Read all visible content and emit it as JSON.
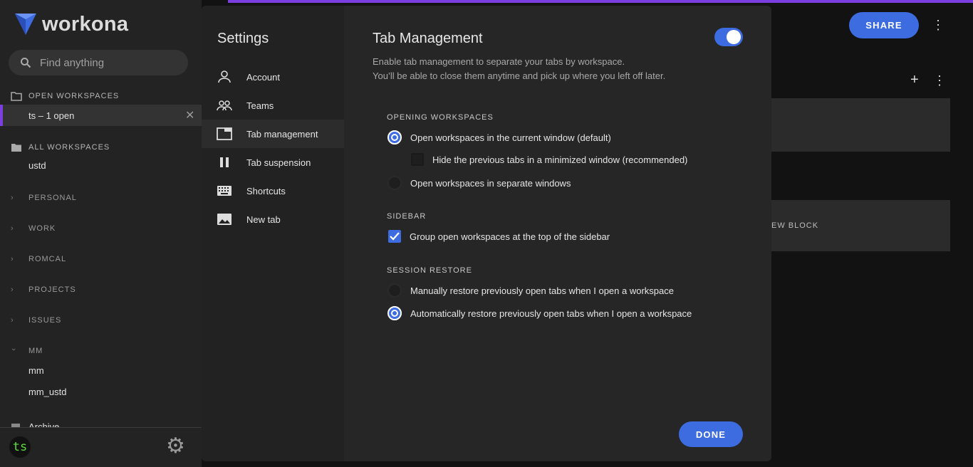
{
  "app": {
    "logo_text": "workona"
  },
  "search": {
    "placeholder": "Find anything"
  },
  "sidebar": {
    "open_workspaces_title": "OPEN WORKSPACES",
    "open_item_label": "ts – 1 open",
    "all_workspaces_title": "ALL WORKSPACES",
    "all_item": "ustd",
    "groups": [
      "PERSONAL",
      "WORK",
      "ROMCAL",
      "PROJECTS",
      "ISSUES",
      "MM"
    ],
    "mm_items": [
      "mm",
      "mm_ustd"
    ],
    "archive": "Archive",
    "avatar_text": "ts"
  },
  "header": {
    "share_label": "SHARE"
  },
  "background": {
    "new_block_label": "EW BLOCK"
  },
  "settings": {
    "title": "Settings",
    "nav": [
      "Account",
      "Teams",
      "Tab management",
      "Tab suspension",
      "Shortcuts",
      "New tab"
    ],
    "active_nav": "Tab management",
    "page_title": "Tab Management",
    "toggle_on": true,
    "desc_line1": "Enable tab management to separate your tabs by workspace.",
    "desc_line2": "You’ll be able to close them anytime and pick up where you left off later.",
    "opening_title": "OPENING WORKSPACES",
    "opening_opt1": "Open workspaces in the current window (default)",
    "opening_sub": "Hide the previous tabs in a minimized window (recommended)",
    "opening_opt2": "Open workspaces in separate windows",
    "sidebar_title": "SIDEBAR",
    "sidebar_opt": "Group open workspaces at the top of the sidebar",
    "restore_title": "SESSION RESTORE",
    "restore_opt1": "Manually restore previously open tabs when I open a workspace",
    "restore_opt2": "Automatically restore previously open tabs when I open a workspace",
    "done_label": "DONE"
  },
  "colors": {
    "accent": "#3d6be0",
    "purple": "#7b3fe0"
  }
}
